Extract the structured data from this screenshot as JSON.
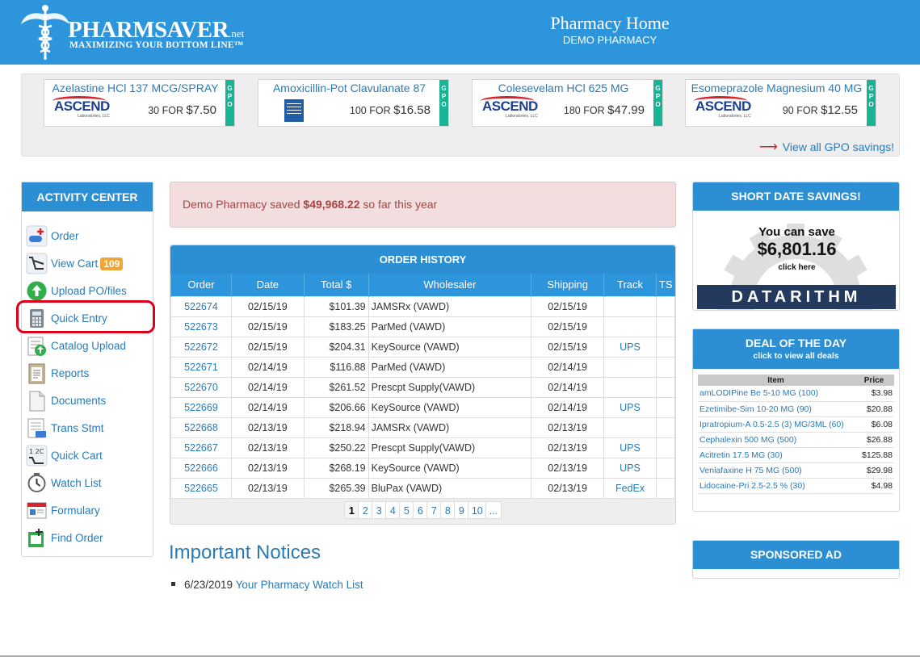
{
  "header": {
    "brand": "PHARMSAVER",
    "brand_suffix": ".net",
    "tagline": "MAXIMIZING YOUR BOTTOM LINE™",
    "title": "Pharmacy Home",
    "subtitle": "DEMO PHARMACY",
    "bg_color": "#2d95dc"
  },
  "gpo": {
    "strip_label": "GPO",
    "view_all": "View all GPO savings!",
    "cards": [
      {
        "name": "Azelastine HCl 137 MCG/SPRAY",
        "qty": "30 FOR",
        "price": "$7.50",
        "logo": "ASCEND",
        "logo_sub": "Laboratories, LLC"
      },
      {
        "name": "Amoxicillin-Pot Clavulanate 87",
        "qty": "100 FOR",
        "price": "$16.58",
        "logo": "box-logo"
      },
      {
        "name": "Colesevelam HCl 625 MG",
        "qty": "180 FOR",
        "price": "$47.99",
        "logo": "ASCEND",
        "logo_sub": "Laboratories, LLC"
      },
      {
        "name": "Esomeprazole Magnesium 40 MG",
        "qty": "90 FOR",
        "price": "$12.55",
        "logo": "ASCEND",
        "logo_sub": "Laboratories, LLC"
      }
    ]
  },
  "activity": {
    "title": "ACTIVITY CENTER",
    "items": [
      {
        "label": "Order",
        "icon": "order-icon"
      },
      {
        "label": "View Cart",
        "icon": "cart-icon",
        "badge": "109"
      },
      {
        "label": "Upload PO/files",
        "icon": "upload-icon"
      },
      {
        "label": "Quick Entry",
        "icon": "calculator-icon"
      },
      {
        "label": "Catalog Upload",
        "icon": "catalog-upload-icon"
      },
      {
        "label": "Reports",
        "icon": "reports-icon"
      },
      {
        "label": "Documents",
        "icon": "documents-icon"
      },
      {
        "label": "Trans Stmt",
        "icon": "statement-icon"
      },
      {
        "label": "Quick Cart",
        "icon": "quick-cart-icon"
      },
      {
        "label": "Watch List",
        "icon": "watch-icon"
      },
      {
        "label": "Formulary",
        "icon": "formulary-icon"
      },
      {
        "label": "Find Order",
        "icon": "find-order-icon"
      }
    ]
  },
  "savings": {
    "prefix": "Demo Pharmacy saved",
    "amount": "$49,968.22",
    "suffix": "so far this year"
  },
  "order_history": {
    "title": "ORDER HISTORY",
    "columns": [
      "Order",
      "Date",
      "Total $",
      "Wholesaler",
      "Shipping",
      "Track",
      "TS"
    ],
    "rows": [
      [
        "522674",
        "02/15/19",
        "$101.39",
        "JAMSRx (VAWD)",
        "02/15/19",
        "",
        ""
      ],
      [
        "522673",
        "02/15/19",
        "$183.25",
        "ParMed (VAWD)",
        "02/15/19",
        "",
        ""
      ],
      [
        "522672",
        "02/15/19",
        "$204.31",
        "KeySource (VAWD)",
        "02/15/19",
        "UPS",
        ""
      ],
      [
        "522671",
        "02/14/19",
        "$116.88",
        "ParMed (VAWD)",
        "02/14/19",
        "",
        ""
      ],
      [
        "522670",
        "02/14/19",
        "$261.52",
        "Prescpt Supply(VAWD)",
        "02/14/19",
        "",
        ""
      ],
      [
        "522669",
        "02/14/19",
        "$206.66",
        "KeySource (VAWD)",
        "02/14/19",
        "UPS",
        ""
      ],
      [
        "522668",
        "02/13/19",
        "$218.94",
        "JAMSRx (VAWD)",
        "02/13/19",
        "",
        ""
      ],
      [
        "522667",
        "02/13/19",
        "$250.22",
        "Prescpt Supply(VAWD)",
        "02/13/19",
        "UPS",
        ""
      ],
      [
        "522666",
        "02/13/19",
        "$268.19",
        "KeySource (VAWD)",
        "02/13/19",
        "UPS",
        ""
      ],
      [
        "522665",
        "02/13/19",
        "$265.39",
        "BluPax (VAWD)",
        "02/13/19",
        "FedEx",
        ""
      ]
    ],
    "pages": [
      "1",
      "2",
      "3",
      "4",
      "5",
      "6",
      "7",
      "8",
      "9",
      "10",
      "..."
    ],
    "current_page": "1"
  },
  "notices": {
    "title": "Important Notices",
    "items": [
      {
        "date": "6/23/2019",
        "link": "Your Pharmacy Watch List"
      }
    ]
  },
  "short_date": {
    "title": "SHORT DATE SAVINGS!",
    "line1": "You can save",
    "amount": "$6,801.16",
    "cta": "click here",
    "logo": "DATARITHM"
  },
  "deal": {
    "title": "DEAL OF THE DAY",
    "subtitle": "click to view all deals",
    "columns": [
      "Item",
      "Price"
    ],
    "rows": [
      [
        "amLODIPine Be 5-10 MG (100)",
        "$3.98"
      ],
      [
        "Ezetimibe-Sim 10-20 MG (90)",
        "$20.88"
      ],
      [
        "Ipratropium-A 0.5-2.5 (3) MG/3ML (60)",
        "$6.08"
      ],
      [
        "Cephalexin 500 MG (500)",
        "$26.88"
      ],
      [
        "Acitretin 17.5 MG (30)",
        "$125.88"
      ],
      [
        "Venlafaxine H 75 MG (500)",
        "$29.98"
      ],
      [
        "Lidocaine-Pri 2.5-2.5 % (30)",
        "$4.98"
      ]
    ]
  },
  "sponsored": {
    "title": "SPONSORED AD"
  }
}
